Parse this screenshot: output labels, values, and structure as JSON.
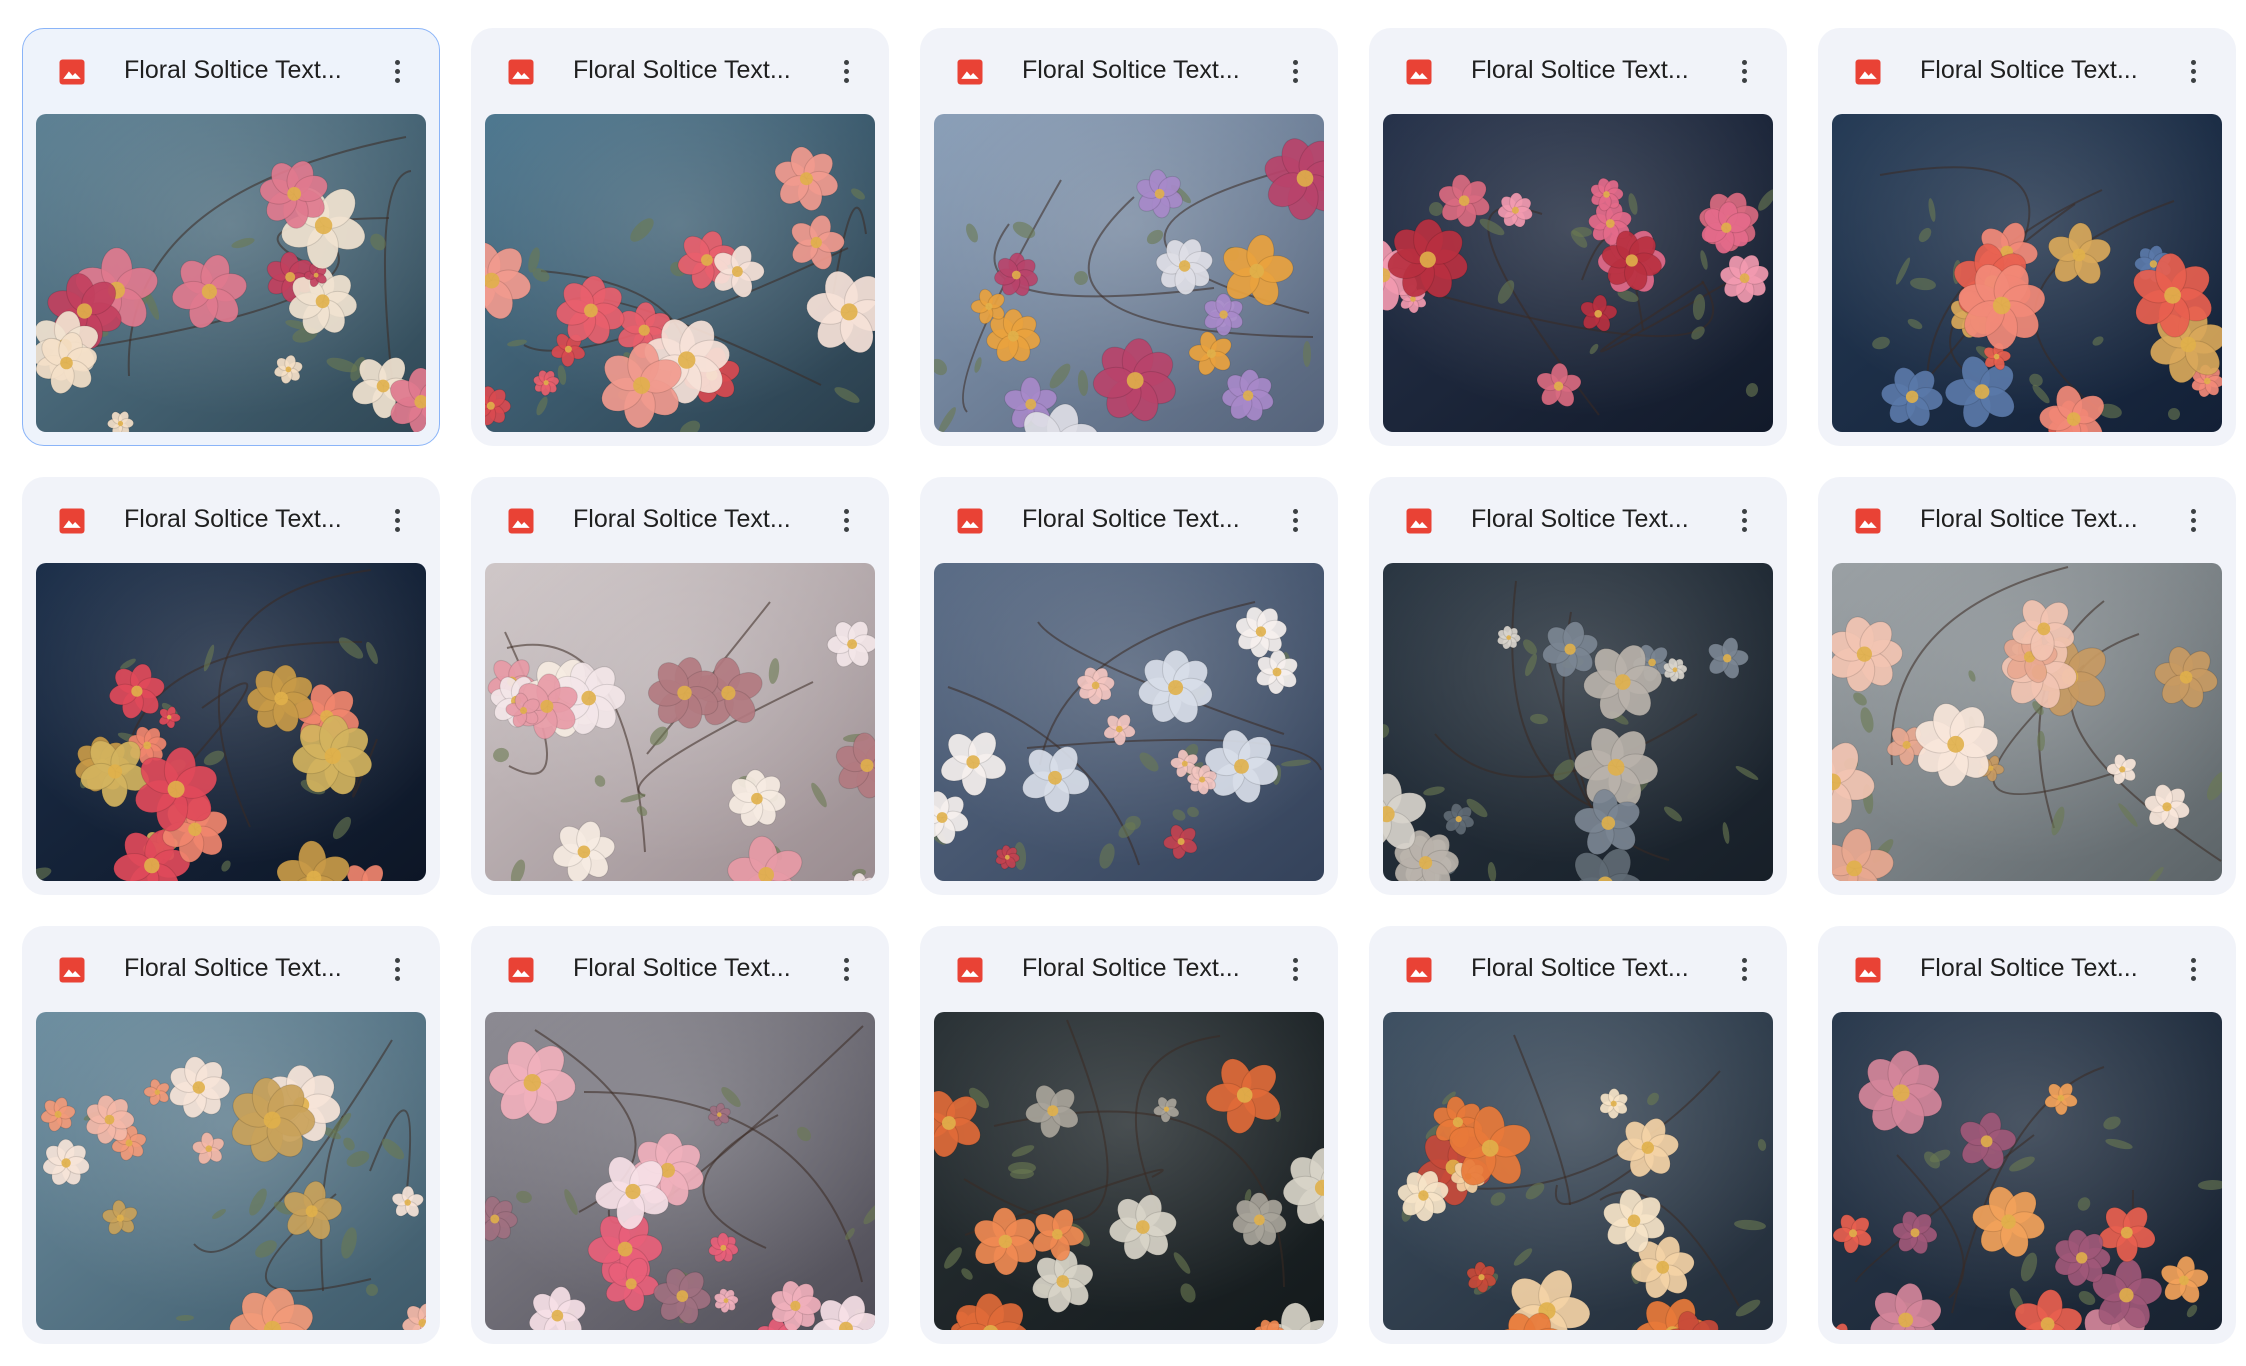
{
  "files": [
    {
      "name": "Floral Soltice Text...",
      "selected": true,
      "thumbnail": {
        "bg": [
          "#5d8194",
          "#2f4755"
        ],
        "flowers": [
          "#f1e3d0",
          "#e07a8e",
          "#c2405e",
          "#f4e0c8"
        ]
      }
    },
    {
      "name": "Floral Soltice Text...",
      "selected": false,
      "thumbnail": {
        "bg": [
          "#4e7890",
          "#2a3e4c"
        ],
        "flowers": [
          "#e8606c",
          "#f19a8e",
          "#f6e2d8",
          "#d94a50"
        ]
      }
    },
    {
      "name": "Floral Soltice Text...",
      "selected": false,
      "thumbnail": {
        "bg": [
          "#8a9fb8",
          "#55637a"
        ],
        "flowers": [
          "#a789c9",
          "#e9a23e",
          "#dedee6",
          "#b8436a"
        ]
      }
    },
    {
      "name": "Floral Soltice Text...",
      "selected": false,
      "thumbnail": {
        "bg": [
          "#26324a",
          "#121a2a"
        ],
        "flowers": [
          "#f29ab0",
          "#e46a8a",
          "#b83040",
          "#d96a80"
        ]
      }
    },
    {
      "name": "Floral Soltice Text...",
      "selected": false,
      "thumbnail": {
        "bg": [
          "#243a55",
          "#132036"
        ],
        "flowers": [
          "#e8604f",
          "#f28a78",
          "#d9a85a",
          "#5a78a8"
        ]
      }
    },
    {
      "name": "Floral Soltice Text...",
      "selected": false,
      "thumbnail": {
        "bg": [
          "#1c2f4a",
          "#0d1626"
        ],
        "flowers": [
          "#f0856e",
          "#e04a5a",
          "#c89a48",
          "#d2b35e"
        ]
      }
    },
    {
      "name": "Floral Soltice Text...",
      "selected": false,
      "thumbnail": {
        "bg": [
          "#cfc7c8",
          "#9a8c90"
        ],
        "flowers": [
          "#f3e6e8",
          "#e79aa6",
          "#b27a80",
          "#f6ece2"
        ]
      }
    },
    {
      "name": "Floral Soltice Text...",
      "selected": false,
      "thumbnail": {
        "bg": [
          "#5a6c86",
          "#34425a"
        ],
        "flowers": [
          "#f3c6c0",
          "#f5f0ee",
          "#d8dde8",
          "#c24250"
        ]
      }
    },
    {
      "name": "Floral Soltice Text...",
      "selected": false,
      "thumbnail": {
        "bg": [
          "#2a3642",
          "#171f28"
        ],
        "flowers": [
          "#d8d4cc",
          "#7b8692",
          "#b8b2aa",
          "#606a74"
        ]
      }
    },
    {
      "name": "Floral Soltice Text...",
      "selected": false,
      "thumbnail": {
        "bg": [
          "#9aa0a4",
          "#5c6468"
        ],
        "flowers": [
          "#f2c4b2",
          "#f8e6da",
          "#c89a62",
          "#e8a890"
        ]
      }
    },
    {
      "name": "Floral Soltice Text...",
      "selected": false,
      "thumbnail": {
        "bg": [
          "#6d8ea0",
          "#3e5a6a"
        ],
        "flowers": [
          "#f6e4d8",
          "#f29a7a",
          "#c9a25a",
          "#f4b8a8"
        ]
      }
    },
    {
      "name": "Floral Soltice Text...",
      "selected": false,
      "thumbnail": {
        "bg": [
          "#8c8a92",
          "#4e4c56"
        ],
        "flowers": [
          "#e8607a",
          "#f0b0bc",
          "#a07080",
          "#f6e0e6"
        ]
      }
    },
    {
      "name": "Floral Soltice Text...",
      "selected": false,
      "thumbnail": {
        "bg": [
          "#2a3236",
          "#141a1c"
        ],
        "flowers": [
          "#e06a38",
          "#d8d4c8",
          "#a8a49a",
          "#f08a52"
        ]
      }
    },
    {
      "name": "Floral Soltice Text...",
      "selected": false,
      "thumbnail": {
        "bg": [
          "#3e5062",
          "#222c38"
        ],
        "flowers": [
          "#f4d2a6",
          "#e87a3a",
          "#f6e4c8",
          "#c84a3a"
        ]
      }
    },
    {
      "name": "Floral Soltice Text...",
      "selected": false,
      "thumbnail": {
        "bg": [
          "#2a3a4e",
          "#182230"
        ],
        "flowers": [
          "#a05878",
          "#e8604f",
          "#f2a25a",
          "#d4869a"
        ]
      }
    }
  ],
  "icons": {
    "file_type": "image-file-icon",
    "more": "more-vert-icon"
  },
  "colors": {
    "file_icon": "#e94235",
    "card_bg": "#f1f3f9",
    "selected_border": "#8ab4f8",
    "text": "#1f1f1f"
  }
}
